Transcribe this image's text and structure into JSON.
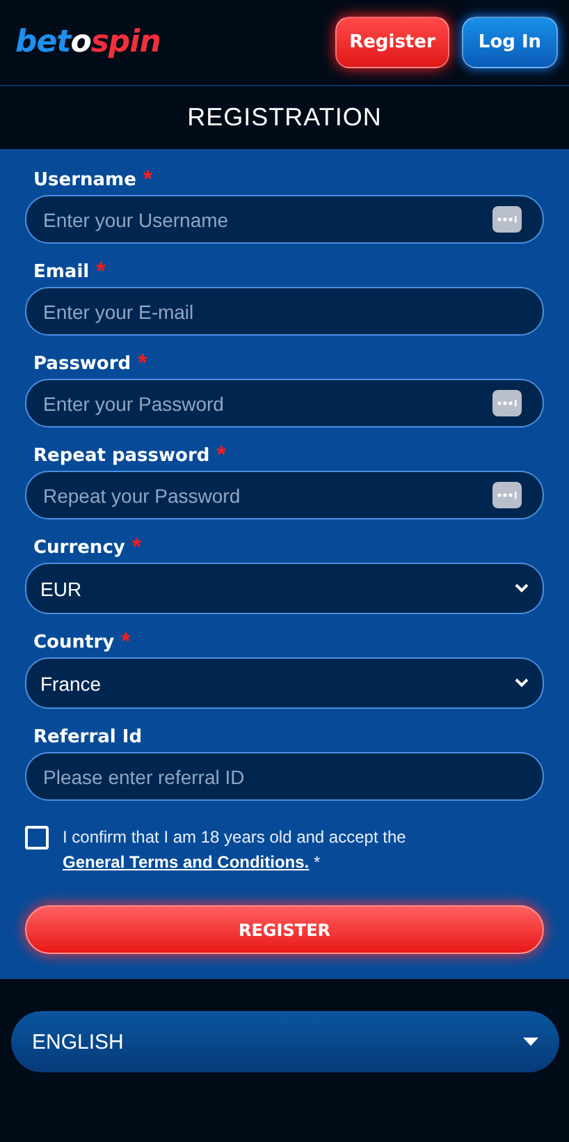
{
  "header": {
    "logo": [
      {
        "text": "bet",
        "color": "#1e8ff0"
      },
      {
        "text": "o",
        "color": "#ffffff"
      },
      {
        "text": "spin",
        "color": "#f0303a"
      }
    ],
    "buttons": [
      {
        "label": "Register",
        "kind": "primary"
      },
      {
        "label": "Log In",
        "kind": "secondary"
      }
    ]
  },
  "title": "REGISTRATION",
  "form": {
    "fields": [
      {
        "label": "Username",
        "required_mark": "*",
        "kind": "text",
        "placeholder": "Enter your Username",
        "key_icon": true
      },
      {
        "label": "Email",
        "required_mark": "*",
        "kind": "text",
        "placeholder": "Enter your E-mail",
        "key_icon": false
      },
      {
        "label": "Password",
        "required_mark": "*",
        "kind": "text",
        "placeholder": "Enter your Password",
        "key_icon": true
      },
      {
        "label": "Repeat password",
        "required_mark": "*",
        "kind": "text",
        "placeholder": "Repeat your Password",
        "key_icon": true
      },
      {
        "label": "Currency",
        "required_mark": "*",
        "kind": "select",
        "value": "EUR"
      },
      {
        "label": "Country",
        "required_mark": "*",
        "kind": "select",
        "value": "France"
      },
      {
        "label": "Referral Id",
        "kind": "text",
        "placeholder": "Please enter referral ID",
        "key_icon": false
      }
    ],
    "consent": {
      "checked": false,
      "text": "I confirm that I am 18 years old and accept the ",
      "link": "General Terms and Conditions.",
      "suffix": " *"
    },
    "submit": "REGISTER"
  },
  "language": {
    "value": "ENGLISH"
  }
}
